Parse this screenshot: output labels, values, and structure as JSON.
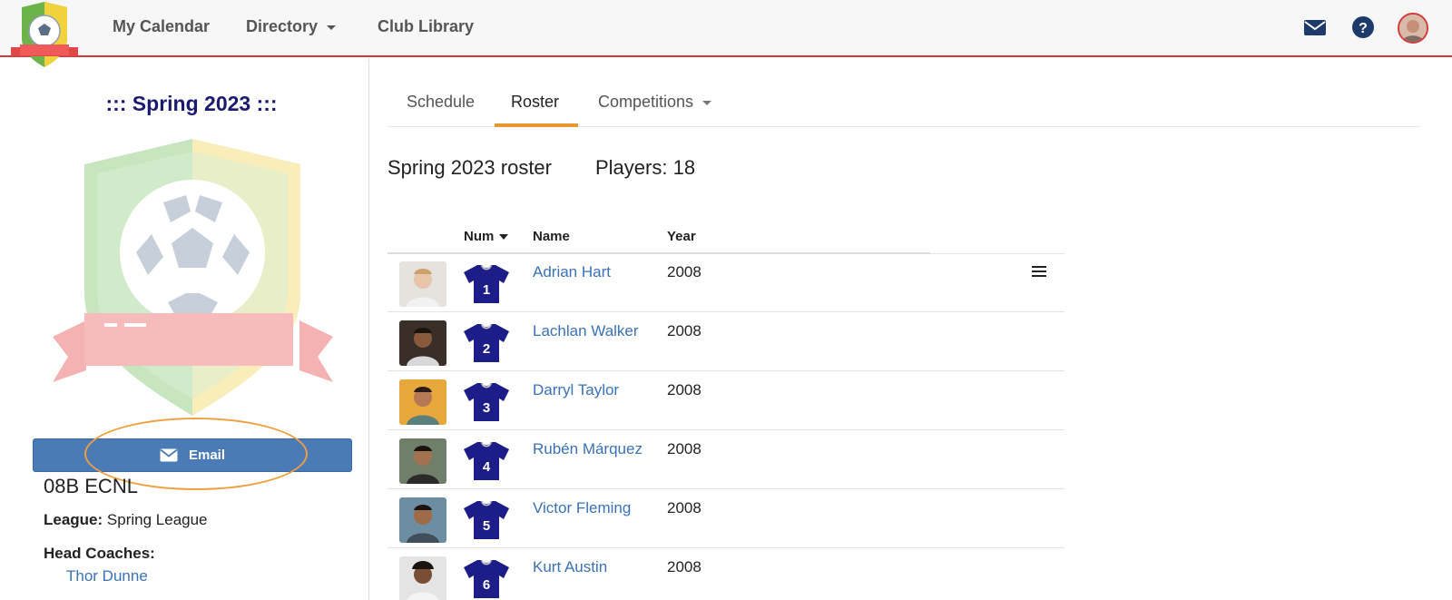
{
  "nav": {
    "items": [
      {
        "label": "My Calendar"
      },
      {
        "label": "Directory",
        "has_dropdown": true
      },
      {
        "label": "Club Library"
      }
    ],
    "icons": [
      "envelope-icon",
      "help-icon",
      "user-avatar"
    ]
  },
  "sidebar": {
    "season_title": "::: Spring 2023 :::",
    "email_label": "Email",
    "team_name": "08B ECNL",
    "league_label": "League:",
    "league_value": "Spring League",
    "head_coaches_label": "Head Coaches:",
    "coaches": [
      "Thor Dunne"
    ]
  },
  "tabs": [
    {
      "label": "Schedule",
      "active": false
    },
    {
      "label": "Roster",
      "active": true
    },
    {
      "label": "Competitions",
      "active": false,
      "has_dropdown": true
    }
  ],
  "roster": {
    "title": "Spring 2023 roster",
    "players_count": "Players: 18",
    "columns": {
      "num": "Num",
      "name": "Name",
      "year": "Year"
    },
    "players": [
      {
        "num": "1",
        "name": "Adrian Hart",
        "year": "2008"
      },
      {
        "num": "2",
        "name": "Lachlan Walker",
        "year": "2008"
      },
      {
        "num": "3",
        "name": "Darryl Taylor",
        "year": "2008"
      },
      {
        "num": "4",
        "name": "Rubén Márquez",
        "year": "2008"
      },
      {
        "num": "5",
        "name": "Victor Fleming",
        "year": "2008"
      },
      {
        "num": "6",
        "name": "Kurt Austin",
        "year": "2008"
      }
    ]
  },
  "colors": {
    "accent": "#e8962e",
    "link": "#3a72b8",
    "button": "#4a7bb7",
    "topbar_border": "#d33a3a",
    "season_title": "#1a1a6e",
    "jersey": "#1d1d8a"
  }
}
